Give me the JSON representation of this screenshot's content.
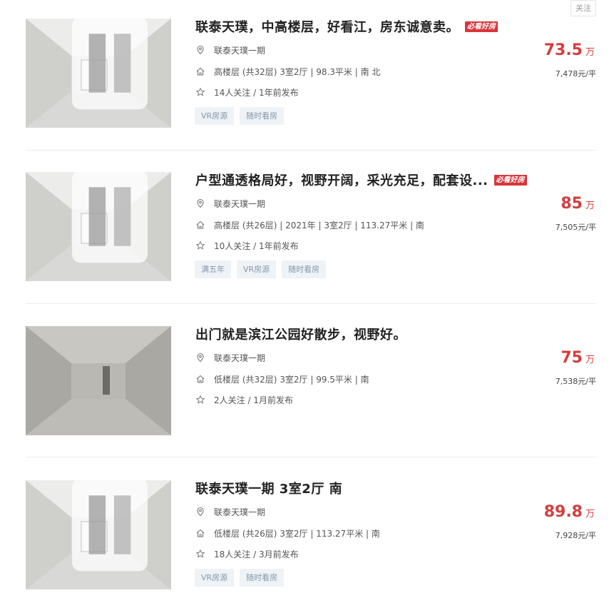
{
  "follow_label": "关注",
  "badge_label": "必看好房",
  "listings": [
    {
      "title": "联泰天璞，中高楼层，好看江，房东诚意卖。",
      "has_badge": true,
      "community": "联泰天璞一期",
      "house_info": "高楼层 (共32层) 3室2厅 | 98.3平米 | 南 北",
      "follow_info": "14人关注 / 1年前发布",
      "tags": [
        "VR房源",
        "随时看房"
      ],
      "price": "73.5",
      "price_unit": "万",
      "unit_price": "7,478元/平",
      "image_icon": "room-photo"
    },
    {
      "title": "户型通透格局好，视野开阔，采光充足，配套设...",
      "has_badge": true,
      "community": "联泰天璞一期",
      "house_info": "高楼层 (共26层) | 2021年 | 3室2厅 | 113.27平米 | 南",
      "follow_info": "10人关注 / 1年前发布",
      "tags": [
        "满五年",
        "VR房源",
        "随时看房"
      ],
      "price": "85",
      "price_unit": "万",
      "unit_price": "7,505元/平",
      "image_icon": "room-photo"
    },
    {
      "title": "出门就是滨江公园好散步，视野好。",
      "has_badge": false,
      "community": "联泰天璞一期",
      "house_info": "低楼层 (共32层) 3室2厅 | 99.5平米 | 南",
      "follow_info": "2人关注 / 1月前发布",
      "tags": [],
      "price": "75",
      "price_unit": "万",
      "unit_price": "7,538元/平",
      "image_icon": "room-photo"
    },
    {
      "title": "联泰天璞一期 3室2厅 南",
      "has_badge": false,
      "community": "联泰天璞一期",
      "house_info": "低楼层 (共26层) 3室2厅 | 113.27平米 | 南",
      "follow_info": "18人关注 / 3月前发布",
      "tags": [
        "VR房源",
        "随时看房"
      ],
      "price": "89.8",
      "price_unit": "万",
      "unit_price": "7,928元/平",
      "image_icon": "room-photo"
    }
  ],
  "icons": {
    "location": "location-pin-icon",
    "house": "house-icon",
    "star": "star-icon",
    "vr": "vr-icon"
  },
  "colors": {
    "price": "#d33e3e",
    "badge": "#d8353a",
    "tag_bg": "#eef3f7",
    "tag_text": "#8797a9"
  }
}
